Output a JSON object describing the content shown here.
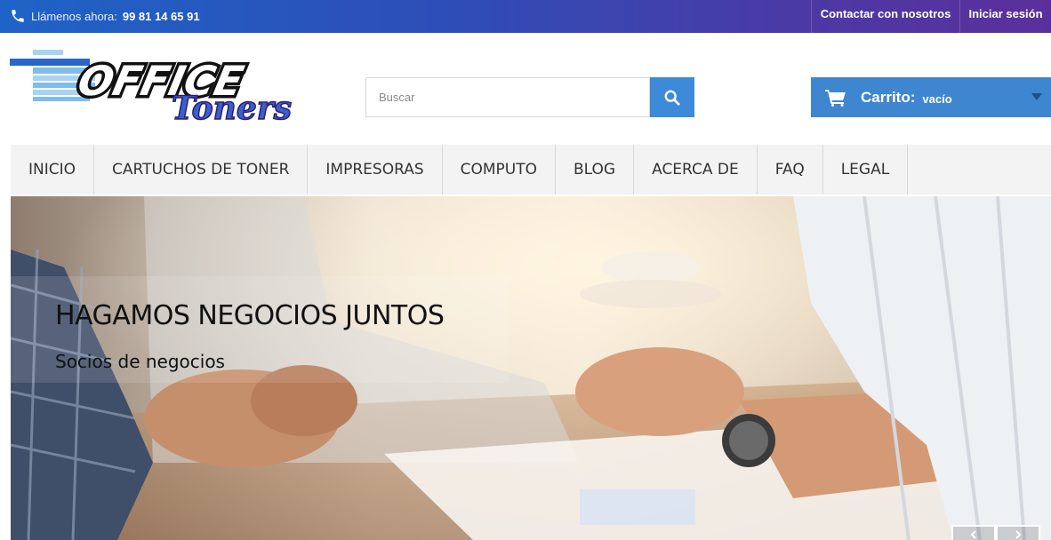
{
  "topbar": {
    "call_label": "Llámenos ahora:",
    "phone": "99 81 14 65 91",
    "contact_link": "Contactar con nosotros",
    "login_link": "Iniciar sesión"
  },
  "header": {
    "logo_text_top": "OFFICE",
    "logo_text_bottom": "Toners",
    "search_placeholder": "Buscar",
    "cart_title": "Carrito:",
    "cart_status": "vacío"
  },
  "nav": {
    "items": [
      "INICIO",
      "CARTUCHOS DE TONER",
      "IMPRESORAS",
      "COMPUTO",
      "BLOG",
      "ACERCA DE",
      "FAQ",
      "LEGAL"
    ]
  },
  "hero": {
    "title": "HAGAMOS NEGOCIOS JUNTOS",
    "subtitle": "Socios de negocios"
  },
  "colors": {
    "topbar_start": "#1f63c6",
    "topbar_end": "#5b2f9b",
    "accent_blue": "#3e86d0",
    "nav_bg": "#f3f3f3"
  },
  "icons": [
    "phone-icon",
    "search-icon",
    "cart-icon",
    "caret-down-icon",
    "chevron-left-icon",
    "chevron-right-icon"
  ]
}
